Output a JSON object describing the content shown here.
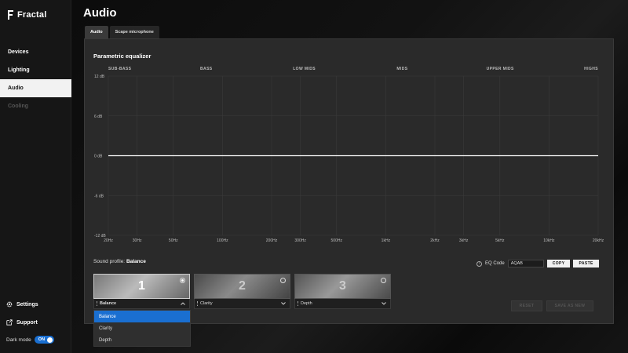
{
  "app": {
    "brand": "Fractal"
  },
  "sidebar": {
    "items": [
      {
        "label": "Devices",
        "state": "normal"
      },
      {
        "label": "Lighting",
        "state": "normal"
      },
      {
        "label": "Audio",
        "state": "active"
      },
      {
        "label": "Cooling",
        "state": "disabled"
      }
    ],
    "settings_label": "Settings",
    "support_label": "Support",
    "dark_mode_label": "Dark mode",
    "dark_mode_value": "ON"
  },
  "page": {
    "title": "Audio"
  },
  "tabs": [
    {
      "label": "Audio",
      "active": true
    },
    {
      "label": "Scape microphone",
      "active": false
    }
  ],
  "equalizer": {
    "title": "Parametric equalizer",
    "bands": [
      "SUB-BASS",
      "BASS",
      "LOW MIDS",
      "MIDS",
      "UPPER MIDS",
      "HIGHS"
    ]
  },
  "chart_data": {
    "type": "line",
    "title": "Parametric equalizer",
    "x_scale": "log",
    "xlim": [
      20,
      20000
    ],
    "ylim": [
      -12,
      12
    ],
    "x_ticks": [
      20,
      30,
      50,
      100,
      200,
      300,
      500,
      1000,
      2000,
      3000,
      5000,
      10000,
      20000
    ],
    "x_tick_labels": [
      "20Hz",
      "30Hz",
      "50Hz",
      "100Hz",
      "200Hz",
      "300Hz",
      "500Hz",
      "1kHz",
      "2kHz",
      "3kHz",
      "5kHz",
      "10kHz",
      "20kHz"
    ],
    "y_ticks": [
      12,
      6,
      0,
      -6,
      -12
    ],
    "y_tick_labels": [
      "12 dB",
      "6 dB",
      "0 dB",
      "-6 dB",
      "-12 dB"
    ],
    "grid": true,
    "series": [
      {
        "x": [
          20,
          20000
        ],
        "y": [
          0,
          0
        ],
        "color": "#ffffff"
      }
    ]
  },
  "profile": {
    "label_prefix": "Sound profile:",
    "current": "Balance",
    "eq_code_label": "EQ Code",
    "eq_code_value": "AQAB",
    "copy_label": "COPY",
    "paste_label": "PASTE",
    "reset_label": "RESET",
    "save_label": "SAVE AS NEW",
    "cards": [
      {
        "number": "1",
        "name": "Balance",
        "selected": true
      },
      {
        "number": "2",
        "name": "Clarity",
        "selected": false
      },
      {
        "number": "3",
        "name": "Depth",
        "selected": false
      }
    ],
    "dropdown_options": [
      "Balance",
      "Clarity",
      "Depth"
    ]
  },
  "colors": {
    "accent": "#1a6fd1",
    "background": "#0b0b0b",
    "panel": "#2a2a2a"
  }
}
